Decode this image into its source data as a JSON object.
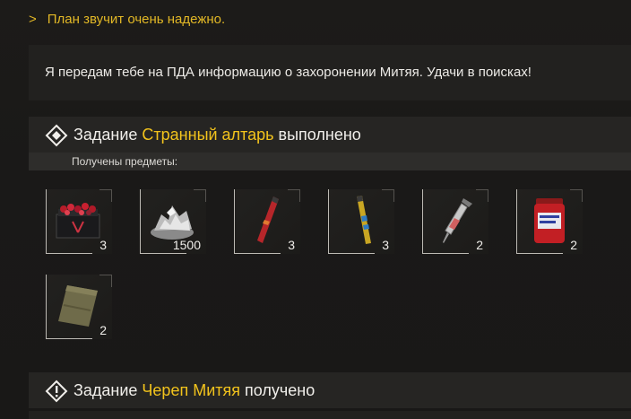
{
  "reply": {
    "arrow": ">",
    "text": "План звучит очень надежно."
  },
  "message": "Я передам тебе на ПДА информацию о захоронении Митяя. Удачи в поисках!",
  "task_completed": {
    "prefix": "Задание",
    "name": "Странный алтарь",
    "suffix": "выполнено"
  },
  "received_label": "Получены предметы:",
  "items": [
    {
      "icon": "ammo-box-icon",
      "count": "3"
    },
    {
      "icon": "silver-pile-icon",
      "count": "1500"
    },
    {
      "icon": "red-stick-icon",
      "count": "3"
    },
    {
      "icon": "yellow-stick-icon",
      "count": "3"
    },
    {
      "icon": "syringe-icon",
      "count": "2"
    },
    {
      "icon": "pill-jar-icon",
      "count": "2"
    },
    {
      "icon": "ration-pack-icon",
      "count": "2"
    }
  ],
  "task_received": {
    "prefix": "Задание",
    "name": "Череп Митяя",
    "suffix": "получено"
  },
  "colors": {
    "accent": "#f2c31c",
    "reply": "#e2b826"
  }
}
